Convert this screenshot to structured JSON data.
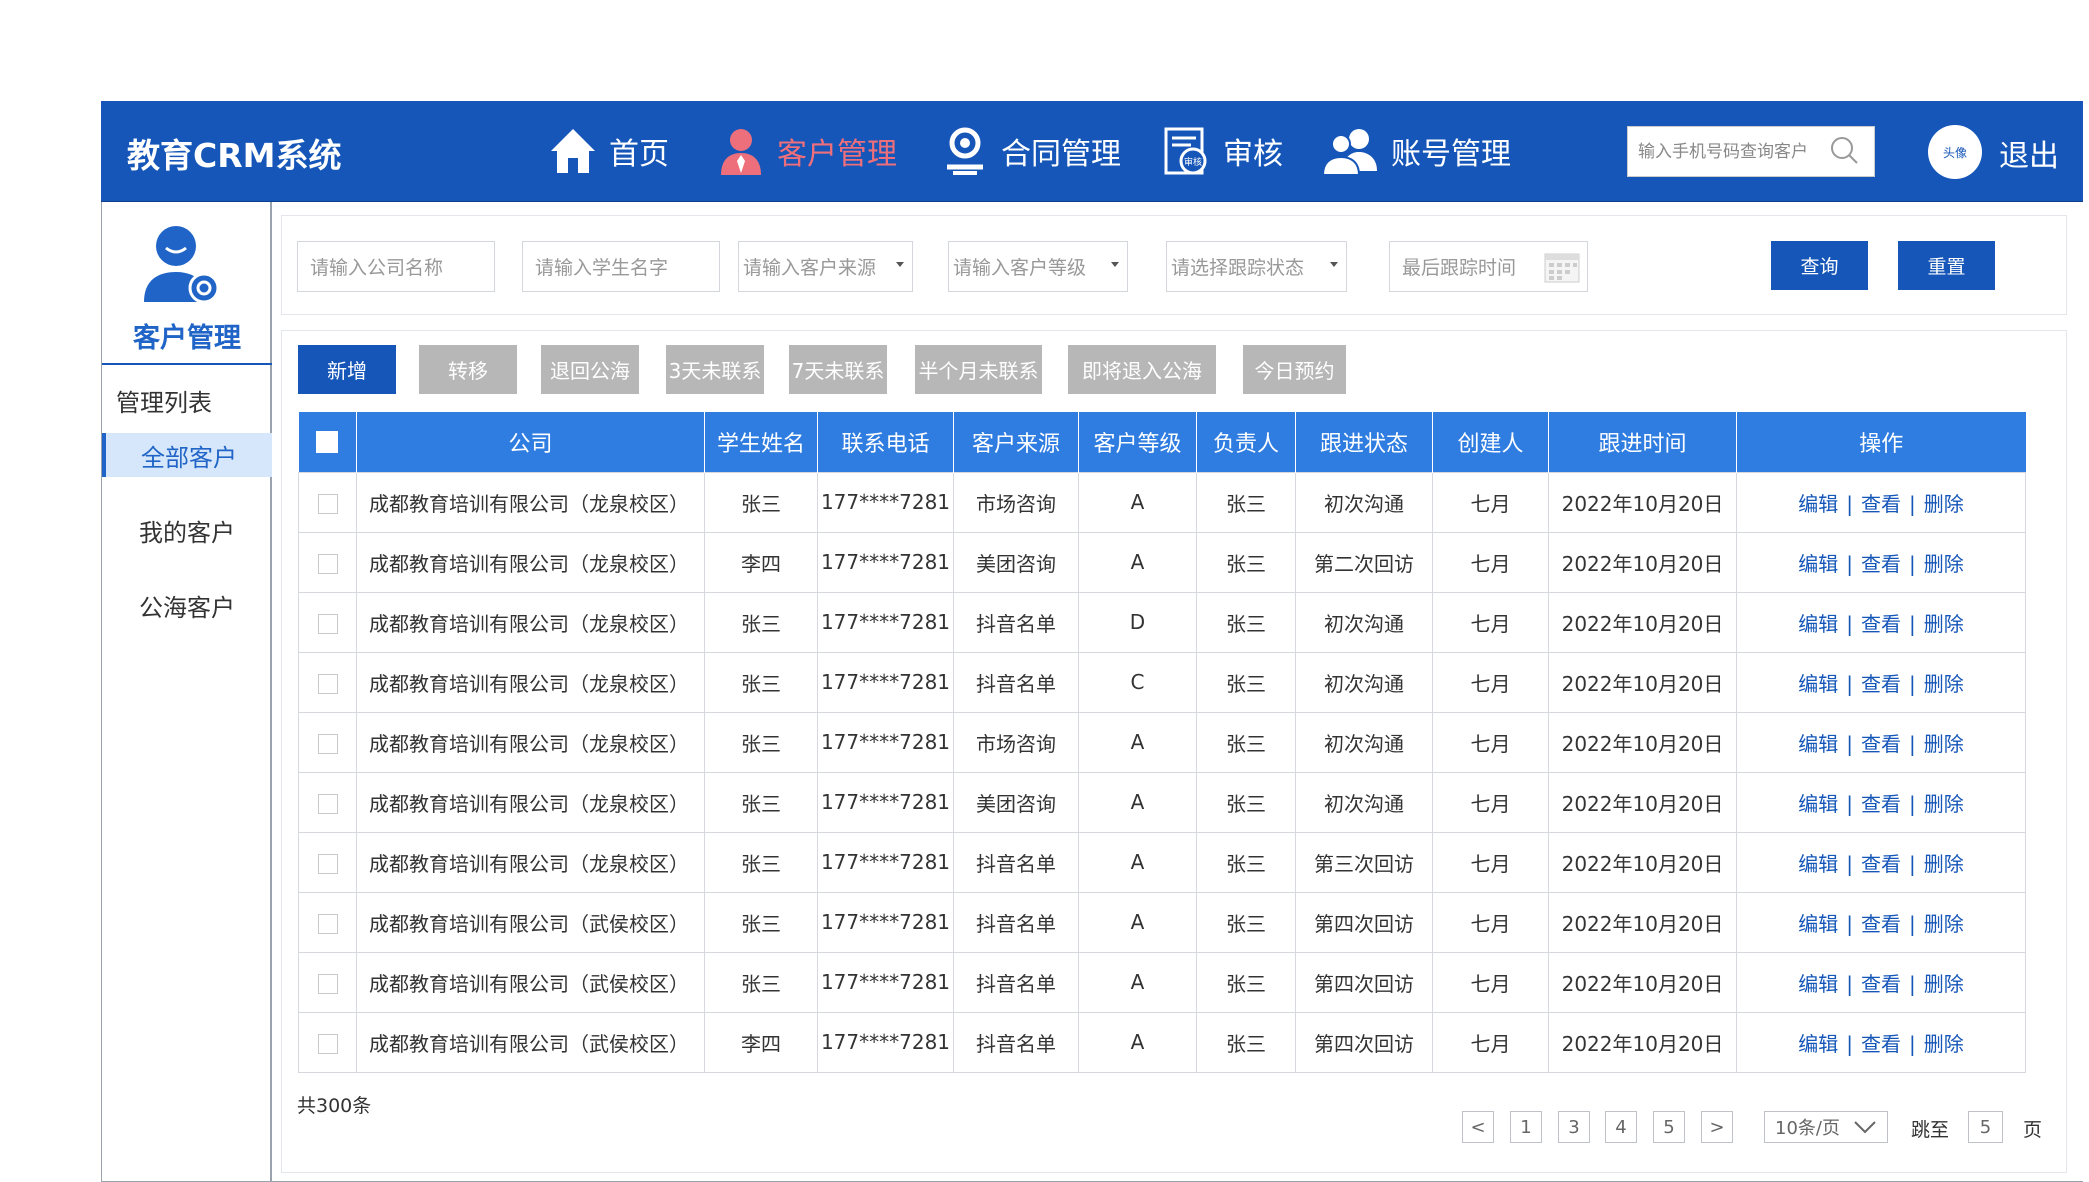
{
  "header": {
    "app_title": "教育CRM系统",
    "nav": [
      {
        "label": "首页",
        "icon": "home-icon"
      },
      {
        "label": "客户管理",
        "icon": "customer-icon"
      },
      {
        "label": "合同管理",
        "icon": "contract-icon"
      },
      {
        "label": "审核",
        "icon": "audit-icon"
      },
      {
        "label": "账号管理",
        "icon": "accounts-icon"
      }
    ],
    "search_placeholder": "输入手机号码查询客户",
    "avatar_label": "头像",
    "logout_label": "退出"
  },
  "sidebar": {
    "title": "客户管理",
    "section": "管理列表",
    "items": [
      {
        "label": "全部客户",
        "active": true
      },
      {
        "label": "我的客户",
        "active": false
      },
      {
        "label": "公海客户",
        "active": false
      }
    ]
  },
  "filters": {
    "company_placeholder": "请输入公司名称",
    "student_placeholder": "请输入学生名字",
    "source_placeholder": "请输入客户来源",
    "level_placeholder": "请输入客户等级",
    "status_placeholder": "请选择跟踪状态",
    "last_time_placeholder": "最后跟踪时间",
    "query_label": "查询",
    "reset_label": "重置"
  },
  "actions": [
    "新增",
    "转移",
    "退回公海",
    "3天未联系",
    "7天未联系",
    "半个月未联系",
    "即将退入公海",
    "今日预约"
  ],
  "table": {
    "columns": [
      "公司",
      "学生姓名",
      "联系电话",
      "客户来源",
      "客户等级",
      "负责人",
      "跟进状态",
      "创建人",
      "跟进时间",
      "操作"
    ],
    "op_labels": [
      "编辑",
      "查看",
      "删除"
    ],
    "op_separator": "|",
    "rows": [
      {
        "company": "成都教育培训有限公司（龙泉校区）",
        "student": "张三",
        "phone": "177****7281",
        "source": "市场咨询",
        "level": "A",
        "owner": "张三",
        "status": "初次沟通",
        "creator": "七月",
        "time": "2022年10月20日"
      },
      {
        "company": "成都教育培训有限公司（龙泉校区）",
        "student": "李四",
        "phone": "177****7281",
        "source": "美团咨询",
        "level": "A",
        "owner": "张三",
        "status": "第二次回访",
        "creator": "七月",
        "time": "2022年10月20日"
      },
      {
        "company": "成都教育培训有限公司（龙泉校区）",
        "student": "张三",
        "phone": "177****7281",
        "source": "抖音名单",
        "level": "D",
        "owner": "张三",
        "status": "初次沟通",
        "creator": "七月",
        "time": "2022年10月20日"
      },
      {
        "company": "成都教育培训有限公司（龙泉校区）",
        "student": "张三",
        "phone": "177****7281",
        "source": "抖音名单",
        "level": "C",
        "owner": "张三",
        "status": "初次沟通",
        "creator": "七月",
        "time": "2022年10月20日"
      },
      {
        "company": "成都教育培训有限公司（龙泉校区）",
        "student": "张三",
        "phone": "177****7281",
        "source": "市场咨询",
        "level": "A",
        "owner": "张三",
        "status": "初次沟通",
        "creator": "七月",
        "time": "2022年10月20日"
      },
      {
        "company": "成都教育培训有限公司（龙泉校区）",
        "student": "张三",
        "phone": "177****7281",
        "source": "美团咨询",
        "level": "A",
        "owner": "张三",
        "status": "初次沟通",
        "creator": "七月",
        "time": "2022年10月20日"
      },
      {
        "company": "成都教育培训有限公司（龙泉校区）",
        "student": "张三",
        "phone": "177****7281",
        "source": "抖音名单",
        "level": "A",
        "owner": "张三",
        "status": "第三次回访",
        "creator": "七月",
        "time": "2022年10月20日"
      },
      {
        "company": "成都教育培训有限公司（武侯校区）",
        "student": "张三",
        "phone": "177****7281",
        "source": "抖音名单",
        "level": "A",
        "owner": "张三",
        "status": "第四次回访",
        "creator": "七月",
        "time": "2022年10月20日"
      },
      {
        "company": "成都教育培训有限公司（武侯校区）",
        "student": "张三",
        "phone": "177****7281",
        "source": "抖音名单",
        "level": "A",
        "owner": "张三",
        "status": "第四次回访",
        "creator": "七月",
        "time": "2022年10月20日"
      },
      {
        "company": "成都教育培训有限公司（武侯校区）",
        "student": "李四",
        "phone": "177****7281",
        "source": "抖音名单",
        "level": "A",
        "owner": "张三",
        "status": "第四次回访",
        "creator": "七月",
        "time": "2022年10月20日"
      }
    ]
  },
  "pagination": {
    "total": "共300条",
    "prev": "<",
    "pages": [
      "1",
      "3",
      "4",
      "5"
    ],
    "next": ">",
    "page_size": "10条/页",
    "jump_label": "跳至",
    "jump_value": "5",
    "page_suffix": "页"
  },
  "colors": {
    "header_bg": "#1556b8",
    "active_nav": "#ee6f7c",
    "table_header": "#2f7de1",
    "link": "#1556b8",
    "button_gray": "#b7b7b7"
  }
}
